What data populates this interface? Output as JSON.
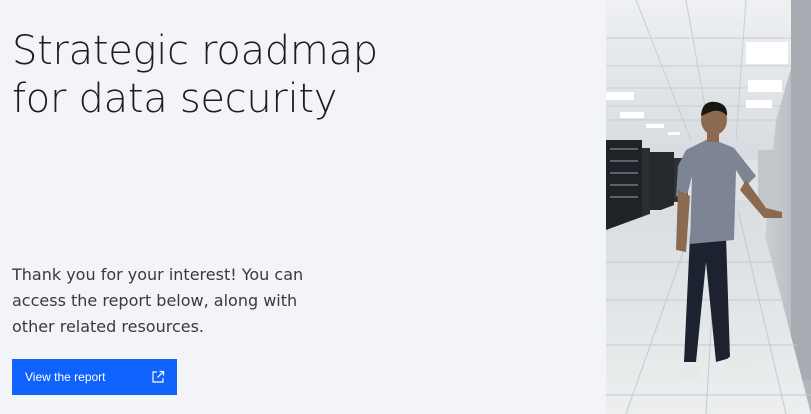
{
  "hero": {
    "title_lines": [
      "Strategic roadmap",
      "for data security"
    ],
    "intro_lines": [
      "Thank you for your interest! You can",
      "access the report below, along with",
      "other related resources."
    ]
  },
  "cta": {
    "label": "View the report",
    "icon": "external-link-icon"
  },
  "photo": {
    "subject": "man-in-data-center-photo"
  },
  "colors": {
    "background": "#f3f4f7",
    "button": "#0f62fe",
    "title_text": "#1d1d1d",
    "body_text": "#3a3a3a"
  }
}
